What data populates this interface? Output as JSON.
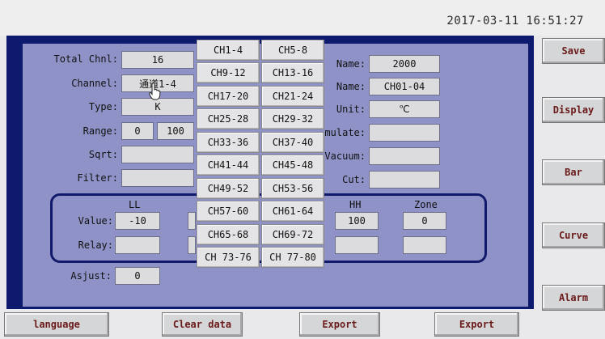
{
  "datetime": "2017-03-11  16:51:27",
  "left_form": {
    "total_chnl_label": "Total Chnl:",
    "total_chnl_value": "16",
    "channel_label": "Channel:",
    "channel_value": "通道1-4",
    "type_label": "Type:",
    "type_value": "K",
    "range_label": "Range:",
    "range_min": "0",
    "range_max": "100",
    "sqrt_label": "Sqrt:",
    "sqrt_value": "",
    "filter_label": "Filter:",
    "filter_value": ""
  },
  "right_form": {
    "name1_label": "Name:",
    "name1_value": "2000",
    "name2_label": "Name:",
    "name2_value": "CH01-04",
    "unit_label": "Unit:",
    "unit_value": "℃",
    "accumulate_label": "mulate:",
    "accumulate_value": "",
    "vacuum_label": "Vacuum:",
    "vacuum_value": "",
    "cut_label": "Cut:",
    "cut_value": ""
  },
  "alarm": {
    "ll_header": "LL",
    "hh_header": "HH",
    "zone_header": "Zone",
    "value_label": "Value:",
    "ll_value": "-10",
    "hh_value": "100",
    "zone_value": "0",
    "relay_label": "Relay:",
    "ll_relay": "",
    "hh_relay": "",
    "zone_relay": ""
  },
  "asjust": {
    "label": "Asjust:",
    "value": "0"
  },
  "channel_popup": [
    [
      "CH1-4",
      "CH5-8"
    ],
    [
      "CH9-12",
      "CH13-16"
    ],
    [
      "CH17-20",
      "CH21-24"
    ],
    [
      "CH25-28",
      "CH29-32"
    ],
    [
      "CH33-36",
      "CH37-40"
    ],
    [
      "CH41-44",
      "CH45-48"
    ],
    [
      "CH49-52",
      "CH53-56"
    ],
    [
      "CH57-60",
      "CH61-64"
    ],
    [
      "CH65-68",
      "CH69-72"
    ],
    [
      "CH 73-76",
      "CH 77-80"
    ]
  ],
  "side_buttons": {
    "save": "Save",
    "display": "Display",
    "bar": "Bar",
    "curve": "Curve",
    "alarm": "Alarm"
  },
  "bottom_buttons": {
    "language": "language",
    "clear_data": "Clear data",
    "export1": "Export",
    "export2": "Export"
  },
  "colors": {
    "panel_border": "#0e1a6e",
    "panel_fill": "#8e92c6",
    "button_text": "#6b1a1a"
  }
}
